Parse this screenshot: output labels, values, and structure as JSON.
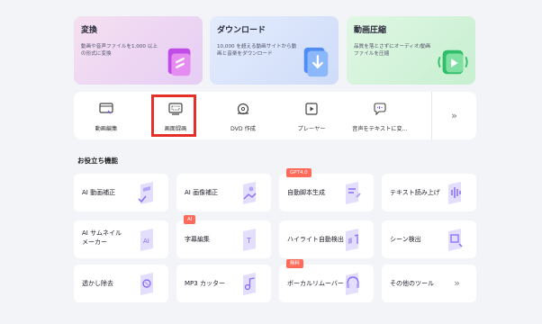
{
  "hero": [
    {
      "title": "変換",
      "desc": "動画や音声ファイルを1,000 以上の形式に変換",
      "icon": "convert-icon",
      "color": "#f1d6f3"
    },
    {
      "title": "ダウンロード",
      "desc": "10,000 を超える動画サイトから動画と音楽をダウンロード",
      "icon": "download-icon",
      "color": "#d7e3fb"
    },
    {
      "title": "動画圧縮",
      "desc": "品質を落とさずにオーディオ/動画ファイルを圧縮",
      "icon": "compress-icon",
      "color": "#d6f5dc"
    }
  ],
  "toolbar": {
    "items": [
      {
        "label": "動画編集",
        "icon": "video-edit-icon"
      },
      {
        "label": "画面録画",
        "icon": "screen-record-icon"
      },
      {
        "label": "DVD 作成",
        "icon": "dvd-icon"
      },
      {
        "label": "プレーヤー",
        "icon": "player-icon"
      },
      {
        "label": "音声をテキストに変…",
        "icon": "speech-to-text-icon"
      }
    ],
    "more": "»"
  },
  "section_title": "お役立ち機能",
  "cards": [
    {
      "label": "AI 動画補正",
      "tag": ""
    },
    {
      "label": "AI 画像補正",
      "tag": ""
    },
    {
      "label": "自動脚本生成",
      "tag": "GPT4.0"
    },
    {
      "label": "テキスト読み上げ",
      "tag": ""
    },
    {
      "label": "AI サムネイル\nメーカー",
      "tag": ""
    },
    {
      "label": "字幕編集",
      "tag": "AI"
    },
    {
      "label": "ハイライト自動検出",
      "tag": ""
    },
    {
      "label": "シーン検出",
      "tag": ""
    },
    {
      "label": "透かし除去",
      "tag": ""
    },
    {
      "label": "MP3 カッター",
      "tag": ""
    },
    {
      "label": "ボーカルリムーバー",
      "tag": "無料"
    },
    {
      "label": "その他のツール",
      "tag": ""
    }
  ],
  "colors": {
    "accent": "#8a6cf7",
    "highlight": "#e5302a",
    "tag": "#ff6b5b"
  }
}
